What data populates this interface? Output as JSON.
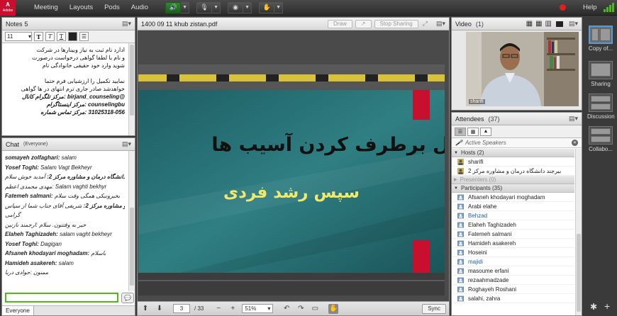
{
  "topbar": {
    "logo_label": "Adobe",
    "menus": [
      "Meeting",
      "Layouts",
      "Pods",
      "Audio"
    ],
    "help": "Help"
  },
  "notes": {
    "title": "Notes",
    "count": "5",
    "font_size": "11",
    "body_lines": [
      {
        "text": "ادارد نام ثبت به نیاز وبینارها در شرکت",
        "bold": false
      },
      {
        "text": "و نام با لطفا گواهی درخواست درصورت",
        "bold": false
      },
      {
        "text": "شوید وارد خود حقیقی خانوادگی نام",
        "bold": false
      },
      {
        "text": "",
        "bold": false
      },
      {
        "text": "نمایید تکمیل را ارزشیابی فرم حتما",
        "bold": false
      },
      {
        "text": "خواهدشد صادر جاری ترم انتهای در ها گواهی",
        "bold": false
      },
      {
        "text": "@birjand_counseling :مرکز تلگرام کانال",
        "bold": true
      },
      {
        "text": "counselingbu :مرکز اینستاگرام",
        "bold": true
      },
      {
        "text": "31025318-056 :مرکز تماس شماره",
        "bold": true
      }
    ]
  },
  "chat": {
    "title": "Chat",
    "audience": "(Everyone)",
    "messages": [
      {
        "who": "somayeh zolfaghari:",
        "msg": "salam"
      },
      {
        "who": "Yosef Toghi:",
        "msg": "Salam Vagt Bekheyr"
      },
      {
        "who": "بیرجند دانشگاه درمان و مشاوره مرکز 2:",
        "msg": "آمدید خوش سلام"
      },
      {
        "who": "",
        "msg": "مهدی محمدی اعظم: Salam vaghti bekhyr"
      },
      {
        "who": "Fatemeh salmani:",
        "msg": "بخیرونیکی همگی وقت سلام"
      },
      {
        "who": "بیرجند دانشگاه درمان و مشاوره مرکز 2:",
        "msg": "شریفی آقای جناب شما از سپاس"
      },
      {
        "who": "",
        "msg": "گرامی"
      },
      {
        "who": "",
        "msg": "خیر به وقتتون. سلام :ارجمند نازنین"
      },
      {
        "who": "Elaheh Taghizadeh:",
        "msg": "salam vaght bekheyr"
      },
      {
        "who": "Yosef Toghi:",
        "msg": "Dagigan"
      },
      {
        "who": "Afsaneh khodayari moghadam:",
        "msg": "باسلام"
      },
      {
        "who": "Hamideh asakereh:",
        "msg": "salam"
      },
      {
        "who": "",
        "msg": "ممنون :جوادی دریا"
      }
    ],
    "to_label": "Everyone"
  },
  "share": {
    "title": "1400 09 11 khub zistan.pdf",
    "draw_label": "Draw",
    "stop_label": "Stop Sharing",
    "slide_line1": "اول برطرف کردن آسیب ها",
    "slide_line2": "سپس رشد فردی",
    "page_current": "3",
    "page_total": "/ 33",
    "zoom": "51%",
    "sync_label": "Sync"
  },
  "video": {
    "title": "Video",
    "count": "(1)",
    "speaker_name": "sharifi"
  },
  "attendees": {
    "title": "Attendees",
    "count": "(37)",
    "active_speakers": "Active Speakers",
    "hosts_label": "Hosts (2)",
    "hosts": [
      "sharifi",
      "بیرجند دانشگاه درمان و مشاوره مرکز 2"
    ],
    "presenters_label": "Presenters (0)",
    "participants_label": "Participants (35)",
    "participants": [
      {
        "name": "Afsaneh khodayari moghadam",
        "blue": false
      },
      {
        "name": "Arabi elahe",
        "blue": false
      },
      {
        "name": "Behzad",
        "blue": true
      },
      {
        "name": "Elaheh Taghizadeh",
        "blue": false
      },
      {
        "name": "Fatemeh salmani",
        "blue": false
      },
      {
        "name": "Hamideh asakereh",
        "blue": false
      },
      {
        "name": "Hoseini",
        "blue": false
      },
      {
        "name": "majidi",
        "blue": true
      },
      {
        "name": "masoume erfani",
        "blue": false
      },
      {
        "name": "rezaahmadzade",
        "blue": false
      },
      {
        "name": "Roghayeh Roshani",
        "blue": false
      },
      {
        "name": "salahi, zahra",
        "blue": false
      }
    ]
  },
  "rail": {
    "items": [
      "Copy of...",
      "Sharing",
      "Discussion",
      "Collabo..."
    ]
  },
  "colors": {
    "slide_teal": "#2f7f83",
    "slide_title": "#111111",
    "slide_subtitle": "#f2e86b",
    "accent_red": "#c8102e",
    "chat_input_border": "#4cbb17"
  }
}
